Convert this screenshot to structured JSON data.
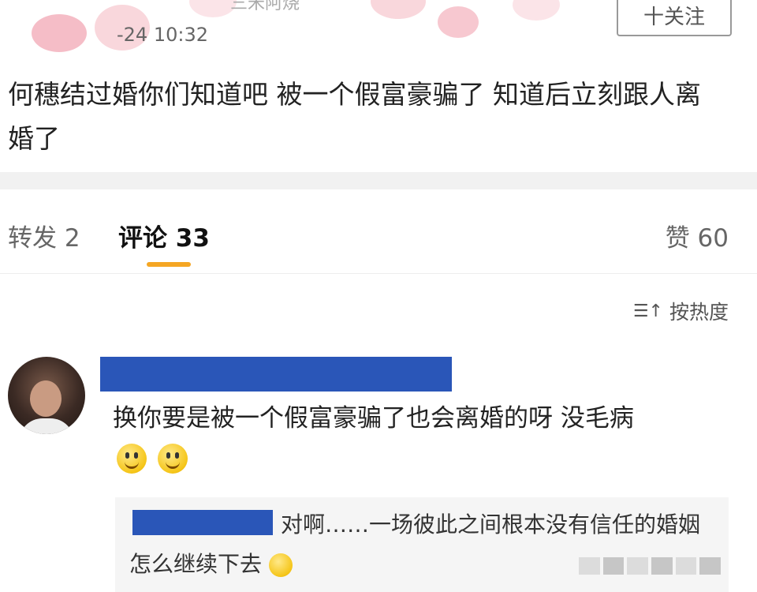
{
  "post": {
    "author_name": "三米阿烧",
    "time": "-24 10:32",
    "follow_label": "十关注",
    "body": "何穗结过婚你们知道吧  被一个假富豪骗了  知道后立刻跟人离婚了"
  },
  "tabs": {
    "repost": "转发 2",
    "comments": "评论 33",
    "likes": "赞 60"
  },
  "sort": {
    "icon": "sort-icon",
    "label": "按热度"
  },
  "comment": {
    "text": "换你要是被一个假富豪骗了也会离婚的呀 没毛病",
    "emojis": [
      "smile-emoji",
      "smile-emoji"
    ],
    "reply": {
      "text": "对啊……一场彼此之间根本没有信任的婚姻 怎么继续下去"
    }
  },
  "colors": {
    "accent_underline": "#f5a623",
    "redaction": "#2a56b8"
  }
}
